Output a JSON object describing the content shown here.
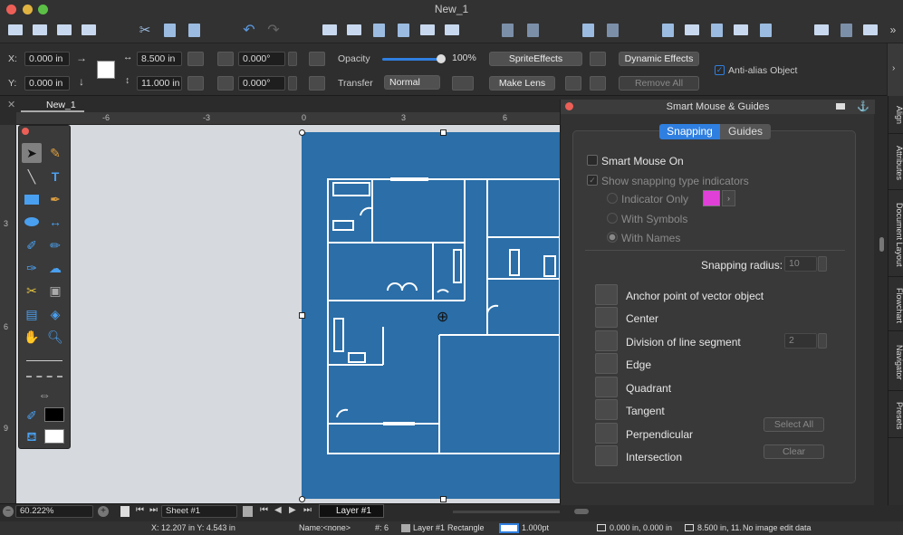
{
  "window": {
    "title": "New_1"
  },
  "toolbar": {
    "icons": [
      "new-doc",
      "open",
      "save",
      "print",
      "cut",
      "copy",
      "paste",
      "undo",
      "redo",
      "layers",
      "layer-stack",
      "layer-down",
      "layer-up",
      "layer-front",
      "layer-back",
      "group",
      "ungroup",
      "lock",
      "unlock",
      "align-tool",
      "frame",
      "rotate",
      "view",
      "fit",
      "notes",
      "monitor",
      "edit",
      "more"
    ]
  },
  "props": {
    "x_label": "X:",
    "x_value": "0.000 in",
    "y_label": "Y:",
    "y_value": "0.000 in",
    "w_value": "8.500 in",
    "h_value": "11.000 in",
    "rot_value": "0.000°",
    "skew_value": "0.000°",
    "opacity_label": "Opacity",
    "opacity_value": "100%",
    "opacity_fraction": 1.0,
    "transfer_label": "Transfer",
    "transfer_value": "Normal",
    "sprite_effects": "SpriteEffects",
    "make_lens": "Make Lens",
    "dynamic_effects": "Dynamic Effects",
    "remove_all": "Remove All",
    "anti_alias": "Anti-alias Object",
    "anti_alias_checked": true
  },
  "doc": {
    "tab": "New_1",
    "ruler_marks": [
      "-6",
      "-3",
      "0",
      "3",
      "6"
    ],
    "vruler_marks": [
      "3",
      "6",
      "9"
    ]
  },
  "panel": {
    "title": "Smart Mouse & Guides",
    "tab_snapping": "Snapping",
    "tab_guides": "Guides",
    "smart_mouse_on": "Smart Mouse On",
    "show_indicators": "Show snapping type indicators",
    "indicator_only": "Indicator Only",
    "with_symbols": "With Symbols",
    "with_names": "With Names",
    "indicator_color": "#e040d8",
    "snap_radius_label": "Snapping radius:",
    "snap_radius_value": "10",
    "items": [
      {
        "label": "Anchor point of vector object"
      },
      {
        "label": "Center"
      },
      {
        "label": "Division of line segment"
      },
      {
        "label": "Edge"
      },
      {
        "label": "Quadrant"
      },
      {
        "label": "Tangent"
      },
      {
        "label": "Perpendicular"
      },
      {
        "label": "Intersection"
      }
    ],
    "division_value": "2",
    "select_all": "Select All",
    "clear": "Clear"
  },
  "sidetabs": [
    "Align",
    "Attributes",
    "Document Layout",
    "Flowchart",
    "Navigator",
    "Presets"
  ],
  "bottom": {
    "zoom": "60.222%",
    "sheet": "Sheet #1",
    "layer": "Layer #1"
  },
  "status": {
    "coords": "X: 12.207 in    Y: 4.543 in",
    "name": "Name:<none>",
    "id": "#: 6",
    "layer": "Layer #1",
    "shape": "Rectangle",
    "stroke": "1.000pt",
    "position": "0.000 in, 0.000 in",
    "size": "8.500 in, 11.",
    "edit": "No image edit data"
  },
  "colors": {
    "accent": "#2b6ea8",
    "selected_tab": "#2f7fe0"
  }
}
